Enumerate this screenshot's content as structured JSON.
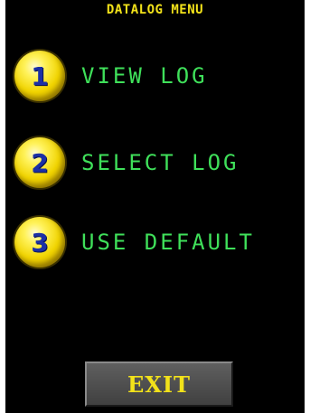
{
  "title": "DATALOG MENU",
  "menu": {
    "items": [
      {
        "number": "1",
        "label": "VIEW LOG"
      },
      {
        "number": "2",
        "label": "SELECT LOG"
      },
      {
        "number": "3",
        "label": "USE DEFAULT"
      }
    ]
  },
  "exit_label": "EXIT",
  "colors": {
    "background": "#000000",
    "title": "#f2e21a",
    "badge": "#f1d400",
    "badge_number": "#1b2fa6",
    "menu_label": "#3fe05a",
    "exit_button": "#505050",
    "exit_label": "#f2e21a"
  }
}
